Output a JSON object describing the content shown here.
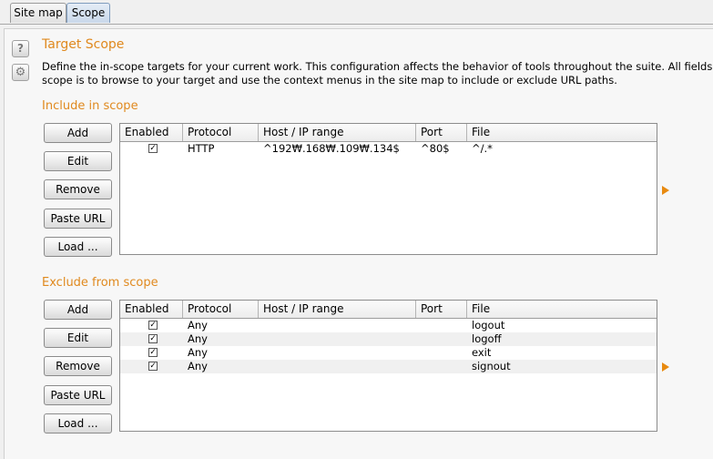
{
  "tabs": [
    {
      "label": "Site map",
      "selected": false
    },
    {
      "label": "Scope",
      "selected": true
    }
  ],
  "icons": {
    "help": "?",
    "gear": "⚙"
  },
  "title": "Target Scope",
  "description": {
    "line1": "Define the in-scope targets for your current work. This configuration affects the behavior of tools throughout the suite. All fields take regex str",
    "line2": "scope is to browse to your target and use the context menus in the site map to include or exclude URL paths."
  },
  "columns": [
    "Enabled",
    "Protocol",
    "Host / IP range",
    "Port",
    "File"
  ],
  "include": {
    "heading": "Include in scope",
    "buttons": {
      "add": "Add",
      "edit": "Edit",
      "remove": "Remove",
      "paste": "Paste URL",
      "load": "Load ..."
    },
    "rows": [
      {
        "enabled": true,
        "protocol": "HTTP",
        "host": "^192₩.168₩.109₩.134$",
        "port": "^80$",
        "file": "^/.*"
      }
    ]
  },
  "exclude": {
    "heading": "Exclude from scope",
    "buttons": {
      "add": "Add",
      "edit": "Edit",
      "remove": "Remove",
      "paste": "Paste URL",
      "load": "Load ..."
    },
    "rows": [
      {
        "enabled": true,
        "protocol": "Any",
        "host": "",
        "port": "",
        "file": "logout"
      },
      {
        "enabled": true,
        "protocol": "Any",
        "host": "",
        "port": "",
        "file": "logoff"
      },
      {
        "enabled": true,
        "protocol": "Any",
        "host": "",
        "port": "",
        "file": "exit"
      },
      {
        "enabled": true,
        "protocol": "Any",
        "host": "",
        "port": "",
        "file": "signout"
      }
    ]
  },
  "colors": {
    "accent": "#e0891e",
    "arrow": "#e88a10"
  }
}
